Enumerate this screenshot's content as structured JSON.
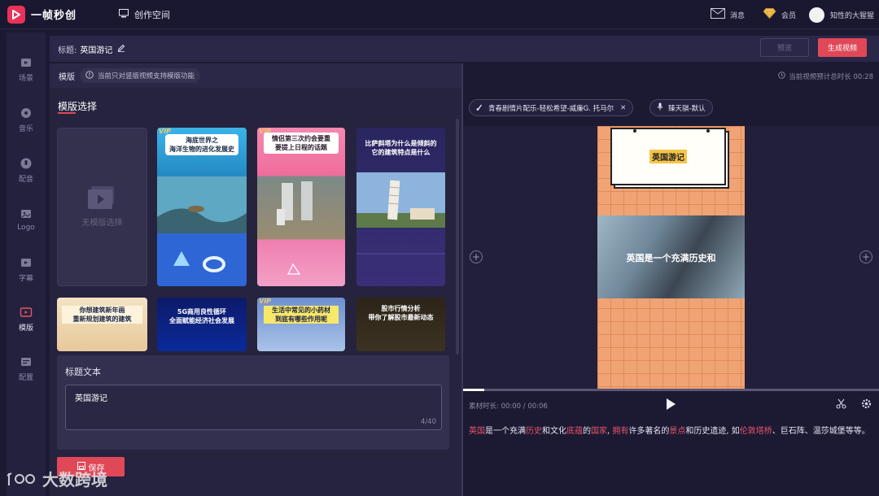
{
  "app": {
    "name": "一帧秒创"
  },
  "topbar": {
    "workspace_label": "创作空间",
    "messages_label": "消息",
    "vip_label": "会员",
    "user_name": "知性的大猩猩"
  },
  "sidebar": {
    "items": [
      {
        "label": "场景",
        "icon": "scene-icon"
      },
      {
        "label": "音乐",
        "icon": "music-icon"
      },
      {
        "label": "配音",
        "icon": "voice-icon"
      },
      {
        "label": "Logo",
        "icon": "logo-icon"
      },
      {
        "label": "字幕",
        "icon": "subtitle-icon"
      },
      {
        "label": "模版",
        "icon": "template-icon",
        "active": true
      },
      {
        "label": "配置",
        "icon": "settings-icon"
      }
    ]
  },
  "header": {
    "title_label": "标题:",
    "title_value": "英国游记",
    "preview_label": "预览",
    "generate_label": "生成视频"
  },
  "template_bar": {
    "label": "模版",
    "notice": "当前只对竖版视频支持模版功能"
  },
  "template_select": {
    "title": "模版选择",
    "none_label": "无模版选择",
    "cards": [
      {
        "vip": "VIP",
        "caption": "海底世界之\n海洋生物的进化发展史"
      },
      {
        "vip": "VIP",
        "caption": "情侣第三次约会要重\n要提上日程的话题"
      },
      {
        "vip": "",
        "caption": "比萨斜塔为什么是倾斜的\n它的建筑特点是什么"
      },
      {
        "vip": "",
        "caption": "你想建筑新年画\n重新规划建筑的建筑"
      },
      {
        "vip": "",
        "caption": "5G商用良性循环\n全面赋能经济社会发展"
      },
      {
        "vip": "VIP",
        "caption": "生活中常见的小药材\n到底有哪些作用呢"
      },
      {
        "vip": "",
        "caption": "股市行情分析\n带你了解股市最新动态"
      }
    ]
  },
  "title_text": {
    "heading": "标题文本",
    "value": "英国游记",
    "counter": "4/40",
    "save_label": "保存"
  },
  "right": {
    "duration_text": "当前视频预计总时长 00:28",
    "music_chip": "青春剧情片配乐-轻松希望-威廉G. 托马尔",
    "voice_chip": "臻天骐-默认",
    "preview": {
      "board_title": "英国游记",
      "photo_caption": "英国是一个充满历史和"
    },
    "playback": {
      "time_text": "素材时长: 00:00 / 00:06",
      "progress": 0.05
    },
    "script": [
      {
        "t": "英国",
        "hl": true
      },
      {
        "t": "是一个充满",
        "hl": false
      },
      {
        "t": "历史",
        "hl": true
      },
      {
        "t": "和文化",
        "hl": false
      },
      {
        "t": "底蕴",
        "hl": true
      },
      {
        "t": "的",
        "hl": false
      },
      {
        "t": "国家",
        "hl": true
      },
      {
        "t": ", ",
        "hl": false
      },
      {
        "t": "拥有",
        "hl": true
      },
      {
        "t": "许多著名的",
        "hl": false
      },
      {
        "t": "景点",
        "hl": true
      },
      {
        "t": "和历史遗迹, 如",
        "hl": false
      },
      {
        "t": "伦敦塔桥",
        "hl": true
      },
      {
        "t": "、巨石阵、温莎城堡等等。",
        "hl": false
      }
    ]
  },
  "watermark": {
    "text": "大数跨境"
  },
  "colors": {
    "accent": "#e04858",
    "bg": "#1c1a33",
    "panel": "#26233f"
  }
}
